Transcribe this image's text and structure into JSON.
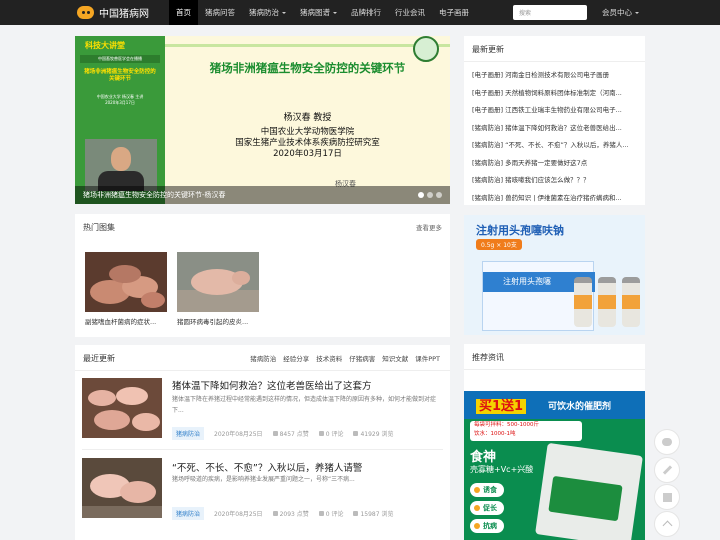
{
  "site": {
    "name": "中国猪病网"
  },
  "nav": {
    "items": [
      {
        "label": "首页",
        "active": true,
        "dropdown": false
      },
      {
        "label": "猪病问答",
        "active": false,
        "dropdown": false
      },
      {
        "label": "猪病防治",
        "active": false,
        "dropdown": true
      },
      {
        "label": "猪病图谱",
        "active": false,
        "dropdown": true
      },
      {
        "label": "品牌排行",
        "active": false,
        "dropdown": false
      },
      {
        "label": "行业会讯",
        "active": false,
        "dropdown": false
      },
      {
        "label": "电子画册",
        "active": false,
        "dropdown": false
      }
    ],
    "search_placeholder": "搜索",
    "member_label": "会员中心"
  },
  "slider": {
    "left_panel": {
      "brand": "科技大讲堂",
      "event_line": "中国畜牧兽医学会在播播",
      "topic": "猪场非洲猪瘟生物安全防控的关键环节",
      "speaker_line": "中国农业大学 杨汉春 主讲",
      "date_line": "2020年3月17日"
    },
    "headline": "猪场非洲猪瘟生物安全防控的关键环节",
    "speaker": "杨汉春  教授",
    "affiliation": [
      "中国农业大学动物医学院",
      "国家生猪产业技术体系疾病防控研究室",
      "2020年03月17日"
    ],
    "signature": "杨汉春",
    "caption": "猪场非洲猪瘟生物安全防控的关键环节-杨汉春",
    "dots": 3,
    "active_dot": 0
  },
  "hot_gallery": {
    "title": "热门图集",
    "more": "查看更多",
    "items": [
      {
        "caption": "副猪嗜血杆菌病的症状..."
      },
      {
        "caption": "猪圆环病毒引起的皮炎..."
      }
    ]
  },
  "latest": {
    "title": "最近更新",
    "tabs": [
      "猪病防治",
      "经验分享",
      "技术资料",
      "仔猪病害",
      "知识文献",
      "课件PPT"
    ],
    "posts": [
      {
        "title": "猪体温下降如何救治？这位老兽医给出了这套方",
        "excerpt": "猪体温下降在养猪过程中经常能遇到这样的情况，但造成体温下降的原因有多种，如何才能做到对症下...",
        "category": "猪病防治",
        "date": "2020年08月25日",
        "likes": "8457 点赞",
        "comments": "0 评论",
        "views": "41929 浏览"
      },
      {
        "title": "“不死、不长、不愈”？入秋以后，养猪人请警",
        "excerpt": "猪场呼吸道的疾病，是影响养猪业发展严重问题之一，号称“三不病...",
        "category": "猪病防治",
        "date": "2020年08月25日",
        "likes": "2093 点赞",
        "comments": "0 评论",
        "views": "15987 浏览"
      }
    ]
  },
  "recent": {
    "title": "最新更新",
    "items": [
      "[电子画册] 河南金日检测技术有限公司电子画册",
      "[电子画册] 天然植物饲料原料团体标准制定（河南...",
      "[电子画册] 江西铁工业瑞丰生物药业有限公司电子...",
      "[猪病防治] 猪体温下降如何救治？这位老兽医给出...",
      "[猪病防治] “不死、不长、不愈”？入秋以后，养猪人...",
      "[猪病防治] 多雨天养猪一定要做好这7点",
      "[猪病防治] 猪咳嗽我们应该怎么做？？？",
      "[猪病防治] 兽药知识 | 伊维菌素在治疗猪疥螨病和..."
    ]
  },
  "ad_top": {
    "title": "注射用头孢噻呋钠",
    "spec": "0.5g × 10支",
    "box_label": "注射用头孢噻"
  },
  "recommend": {
    "title": "推荐资讯",
    "ad": {
      "promo_big": "买1送1",
      "promo_sub": "可饮水的催肥剂",
      "ratio_line1": "每袋可拌料：500-1000斤",
      "ratio_line2": "饮水：1000-1吨",
      "brand": "食神",
      "formula": "壳寡糖+Vc+兴酸",
      "chips": [
        "诱食",
        "促长",
        "抗病"
      ]
    }
  },
  "colors": {
    "topbar": "#222222",
    "slide_green": "#1b8d2f",
    "badge_blue": "#2e7ec9",
    "ad_green": "#0a8d4f"
  }
}
